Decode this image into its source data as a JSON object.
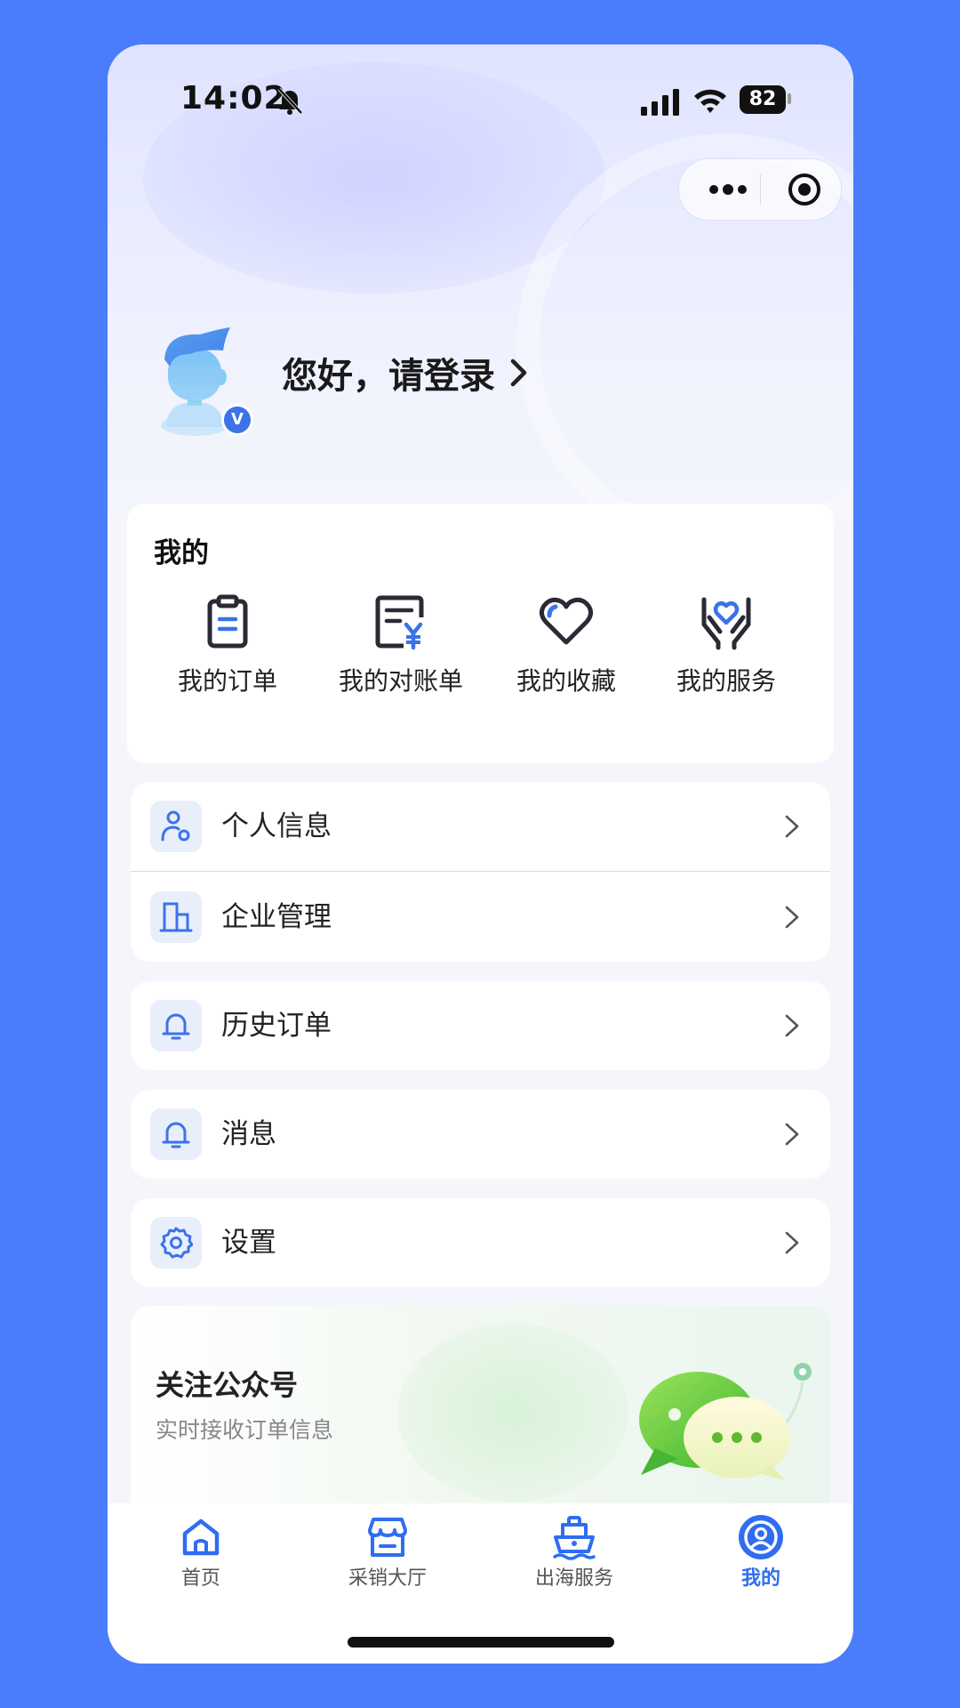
{
  "status_bar": {
    "time": "14:02",
    "battery": "82"
  },
  "profile": {
    "greeting": "您好，请登录",
    "badge": "V"
  },
  "my_section": {
    "title": "我的",
    "items": [
      {
        "label": "我的订单",
        "icon": "clipboard-icon"
      },
      {
        "label": "我的对账单",
        "icon": "statement-yen-icon"
      },
      {
        "label": "我的收藏",
        "icon": "heart-icon"
      },
      {
        "label": "我的服务",
        "icon": "hands-heart-icon"
      }
    ]
  },
  "menu": [
    {
      "label": "个人信息",
      "icon": "person-gear-icon"
    },
    {
      "label": "企业管理",
      "icon": "building-icon"
    },
    {
      "label": "历史订单",
      "icon": "bell-icon"
    },
    {
      "label": "消息",
      "icon": "bell-icon"
    },
    {
      "label": "设置",
      "icon": "gear-icon"
    }
  ],
  "follow": {
    "title": "关注公众号",
    "subtitle": "实时接收订单信息",
    "icon": "wechat-icon"
  },
  "tabbar": [
    {
      "label": "首页",
      "icon": "home-icon"
    },
    {
      "label": "采销大厅",
      "icon": "store-icon"
    },
    {
      "label": "出海服务",
      "icon": "ship-icon"
    },
    {
      "label": "我的",
      "icon": "user-circle-icon",
      "active": true
    }
  ],
  "colors": {
    "accent": "#2f6df2",
    "background": "#4a7dfb",
    "icon_dark": "#2a2a35"
  }
}
